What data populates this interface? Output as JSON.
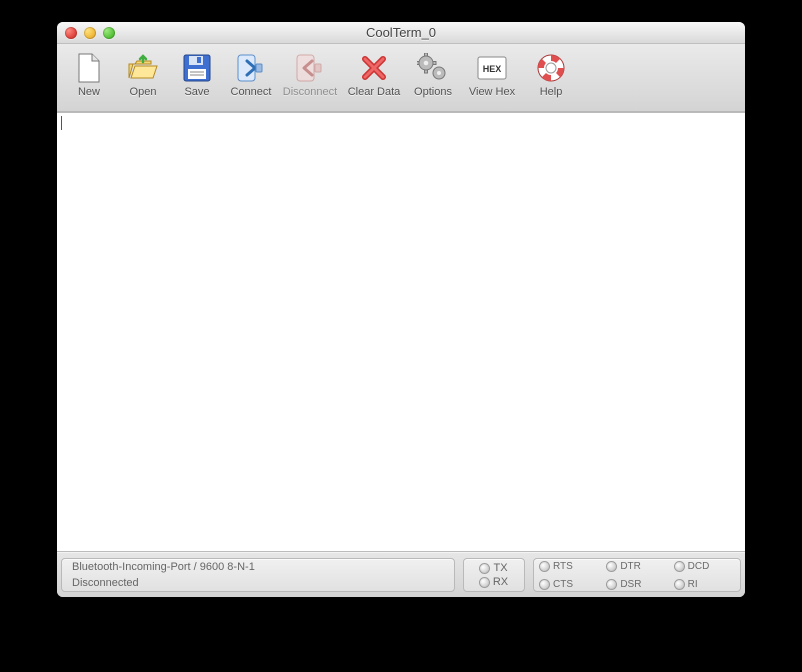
{
  "window": {
    "title": "CoolTerm_0"
  },
  "toolbar": {
    "new": "New",
    "open": "Open",
    "save": "Save",
    "connect": "Connect",
    "disconnect": "Disconnect",
    "clear": "Clear Data",
    "options": "Options",
    "viewhex": "View Hex",
    "help": "Help"
  },
  "status": {
    "port": "Bluetooth-Incoming-Port / 9600 8-N-1",
    "state": "Disconnected",
    "tx": "TX",
    "rx": "RX",
    "rts": "RTS",
    "cts": "CTS",
    "dtr": "DTR",
    "dsr": "DSR",
    "dcd": "DCD",
    "ri": "RI"
  }
}
